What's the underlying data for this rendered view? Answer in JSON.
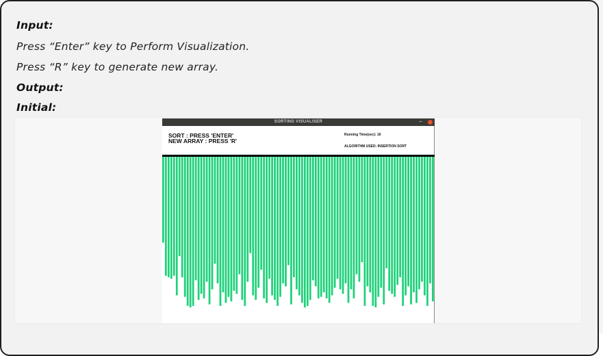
{
  "doc": {
    "input_label": "Input:",
    "line1": "Press “Enter” key to Perform Visualization.",
    "line2": "Press “R” key to generate new array.",
    "output_label": "Output:",
    "initial_label": "Initial:"
  },
  "window": {
    "title": "SORTING VISUALISER",
    "minimize_glyph": "–",
    "sort_instruction": "SORT : PRESS 'ENTER'",
    "new_array_instruction": "NEW ARRAY : PRESS 'R'",
    "running_time": "Running Time(sec): 16",
    "algorithm": "ALGORITHM USED: INSERTION SORT",
    "bar_color": "#1fd17a",
    "close_color": "#e0542c",
    "bar_values": [
      0.57,
      0.79,
      0.8,
      0.81,
      0.79,
      0.92,
      0.66,
      0.8,
      0.93,
      0.99,
      1.0,
      0.99,
      0.82,
      0.95,
      0.91,
      0.94,
      0.83,
      0.98,
      0.88,
      0.71,
      0.84,
      0.99,
      0.9,
      0.97,
      0.93,
      0.96,
      0.89,
      0.91,
      0.78,
      0.95,
      0.99,
      0.83,
      0.64,
      0.92,
      0.95,
      0.87,
      0.75,
      0.94,
      0.97,
      0.81,
      0.92,
      0.95,
      0.99,
      0.93,
      0.84,
      0.86,
      0.72,
      0.98,
      0.8,
      0.88,
      0.92,
      0.97,
      1.0,
      0.99,
      0.95,
      0.82,
      0.86,
      0.94,
      0.93,
      0.9,
      0.94,
      0.97,
      0.92,
      0.87,
      0.81,
      0.88,
      0.91,
      0.84,
      0.97,
      0.88,
      0.94,
      0.78,
      0.83,
      0.7,
      0.99,
      0.86,
      0.9,
      0.99,
      1.0,
      0.93,
      0.87,
      0.98,
      0.74,
      0.89,
      0.91,
      0.93,
      0.85,
      0.8,
      0.99,
      0.92,
      0.86,
      0.98,
      0.9,
      0.97,
      0.88,
      0.83,
      0.92,
      0.99,
      0.84,
      0.96
    ]
  }
}
